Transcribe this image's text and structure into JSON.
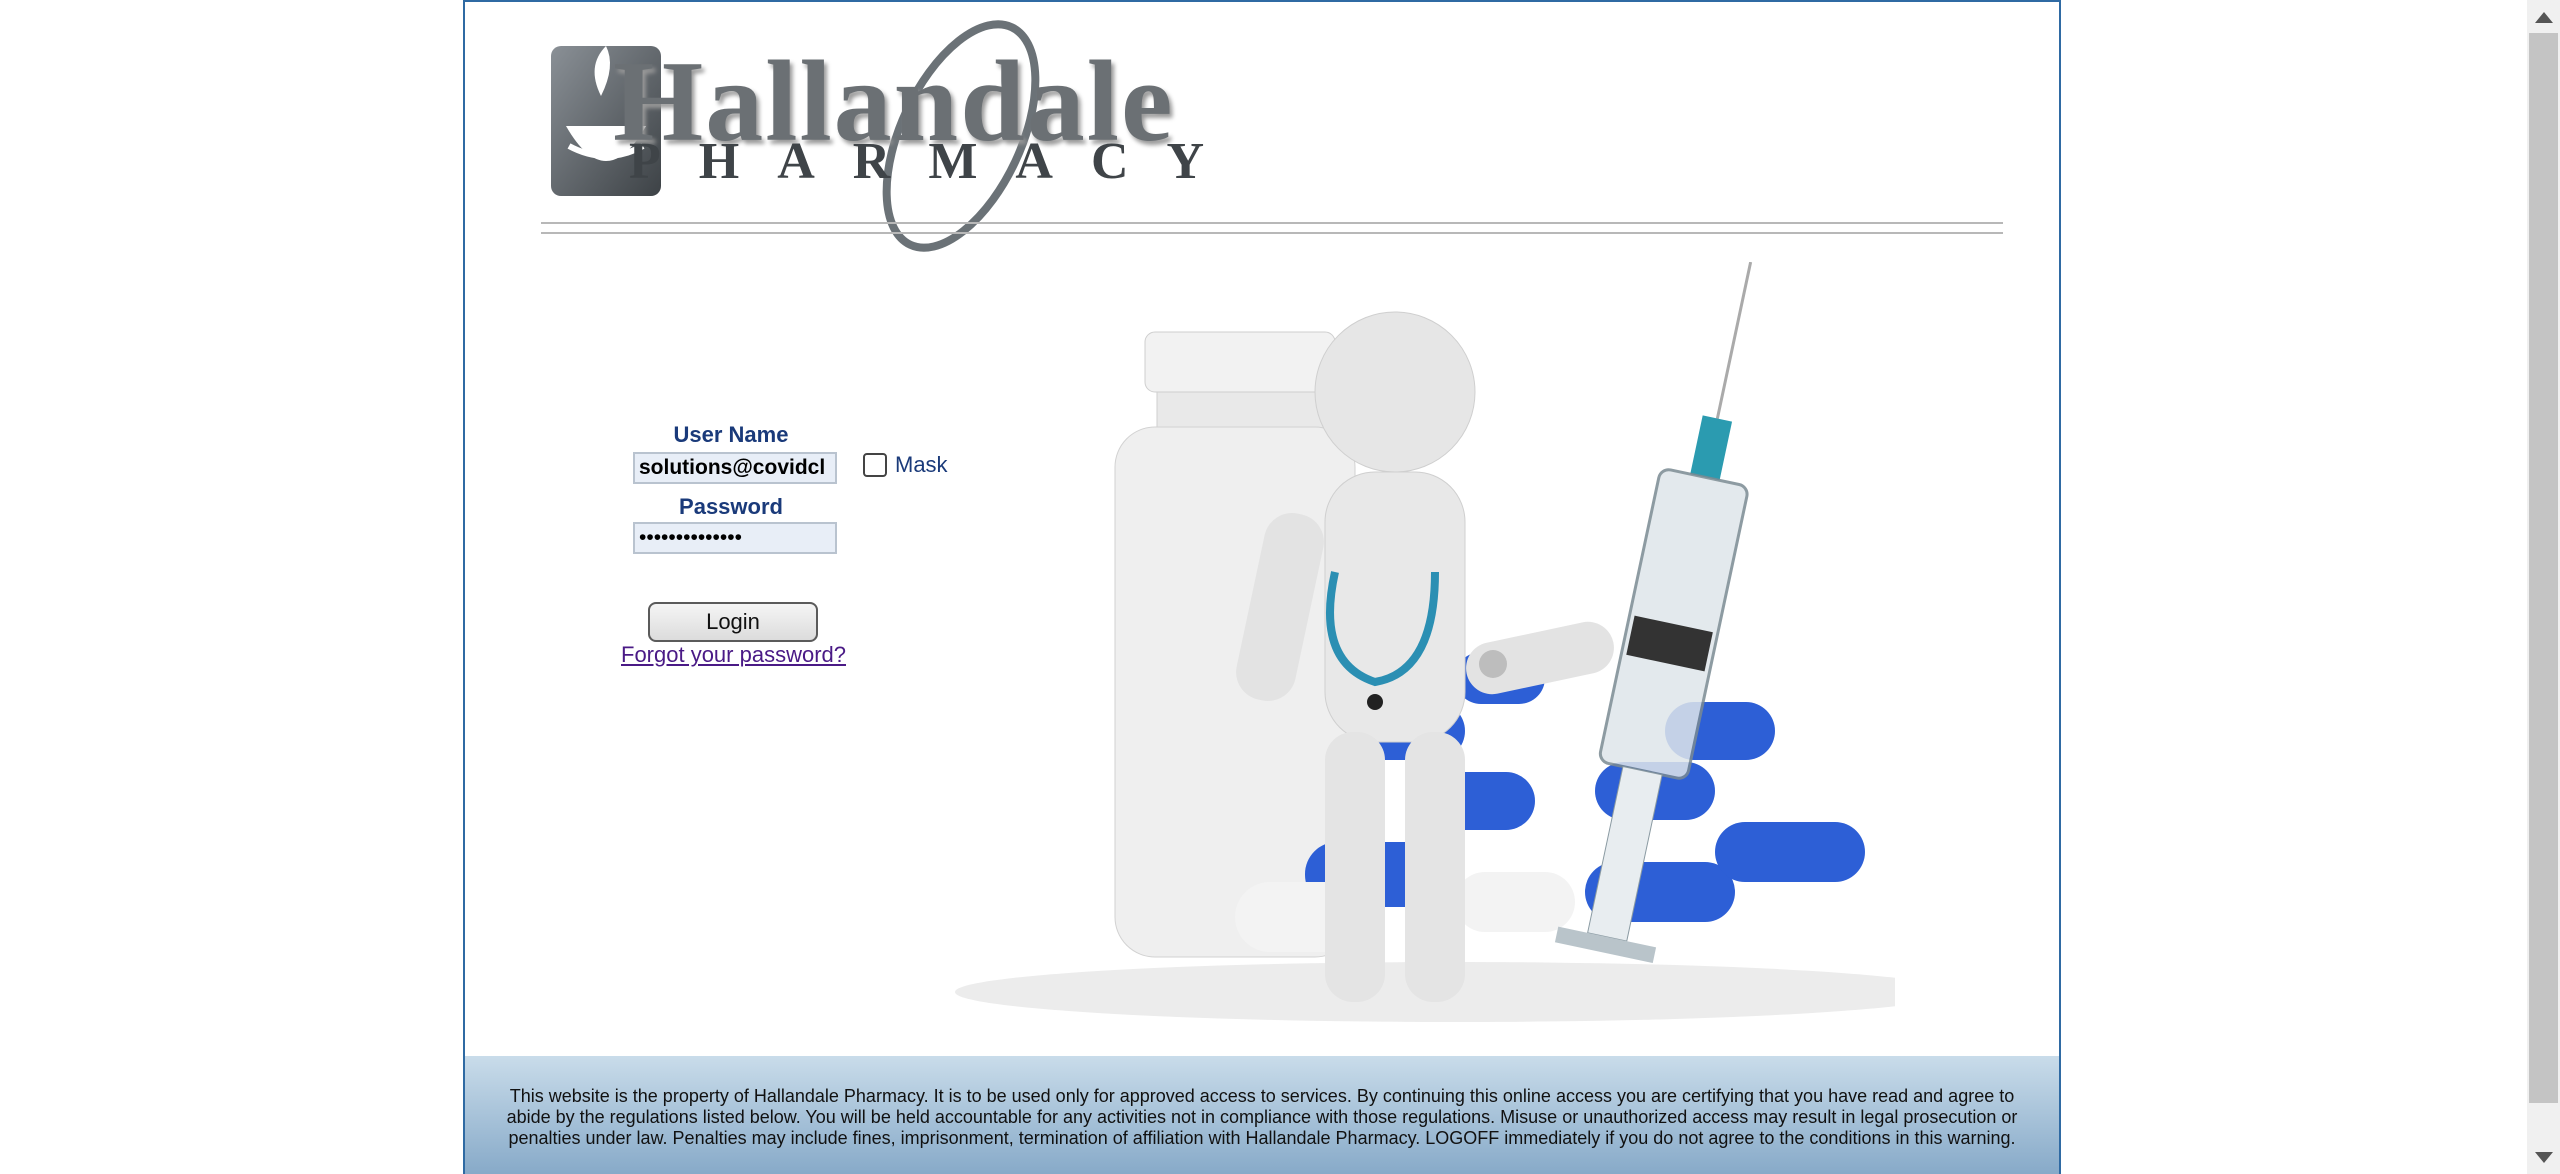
{
  "logo": {
    "brand": "Hallandale",
    "sub": "PHARMACY"
  },
  "login": {
    "username_label": "User Name",
    "username_value": "solutions@covidcl",
    "mask_label": "Mask",
    "mask_checked": false,
    "password_label": "Password",
    "password_value": "••••••••••••••",
    "login_button": "Login",
    "forgot_link": "Forgot your password?"
  },
  "footer": {
    "notice": "This website is the property of Hallandale Pharmacy. It is to be used only for approved access to services. By continuing this online access you are certifying that you have read and agree to abide by the regulations listed below. You will be held accountable for any activities not in compliance with those regulations. Misuse or unauthorized access may result in legal prosecution or penalties under law. Penalties may include fines, imprisonment, termination of affiliation with Hallandale Pharmacy. LOGOFF immediately if you do not agree to the conditions in this warning."
  },
  "colors": {
    "frame_border": "#2f6aa3",
    "label_text": "#1a3a7a",
    "link": "#4a1a86",
    "pill_blue": "#2d5fd6"
  },
  "icons": [
    "logo-cup-icon",
    "pharmacist-illustration"
  ]
}
